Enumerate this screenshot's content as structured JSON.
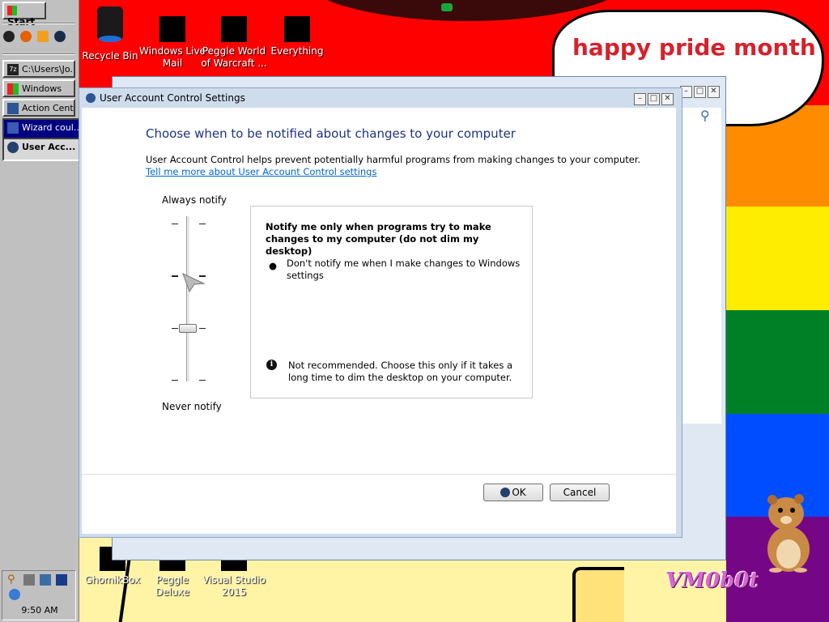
{
  "taskbar": {
    "start_label": "Start",
    "quick_launch_icons": [
      "vm-icon",
      "firefox-icon",
      "media-player-icon",
      "globe-icon"
    ],
    "tasks": [
      {
        "label": "C:\\Users\\Jo...",
        "icon": "archive-icon",
        "state": "normal"
      },
      {
        "label": "Windows",
        "icon": "windows-logo-icon",
        "state": "normal"
      },
      {
        "label": "Action Center",
        "icon": "flag-icon",
        "state": "normal"
      },
      {
        "label": "Wizard coul...",
        "icon": "wizard-icon",
        "state": "active"
      },
      {
        "label": "User Acc...",
        "icon": "shield-icon",
        "state": "pressed"
      }
    ],
    "clock": "9:50 AM"
  },
  "desktop": {
    "icons": [
      {
        "label": "Recycle Bin"
      },
      {
        "label": "Windows Live Mail"
      },
      {
        "label": "Peggle World of Warcraft ..."
      },
      {
        "label": "Everything"
      },
      {
        "label": "GhomikBox"
      },
      {
        "label": "Peggle Deluxe"
      },
      {
        "label": "Visual Studio 2015"
      }
    ],
    "speech_bubble": "happy pride month",
    "watermark": "VM0b0t",
    "pride_colors": [
      "#ff0000",
      "#ff8c00",
      "#ffed00",
      "#008026",
      "#004dff",
      "#750787"
    ]
  },
  "uac_dialog": {
    "title": "User Account Control Settings",
    "heading": "Choose when to be notified about changes to your computer",
    "description": "User Account Control helps prevent potentially harmful programs from making changes to your computer.",
    "link": "Tell me more about User Account Control settings",
    "slider": {
      "top_label": "Always notify",
      "bottom_label": "Never notify",
      "levels": 4,
      "selected_level": 2
    },
    "info": {
      "title": "Notify me only when programs try to make changes to my computer (do not dim my desktop)",
      "bullet": "Don't notify me when I make changes to Windows settings",
      "warning": "Not recommended. Choose this only if it takes a long time to dim the desktop on your computer."
    },
    "ok_label": "OK",
    "cancel_label": "Cancel"
  }
}
